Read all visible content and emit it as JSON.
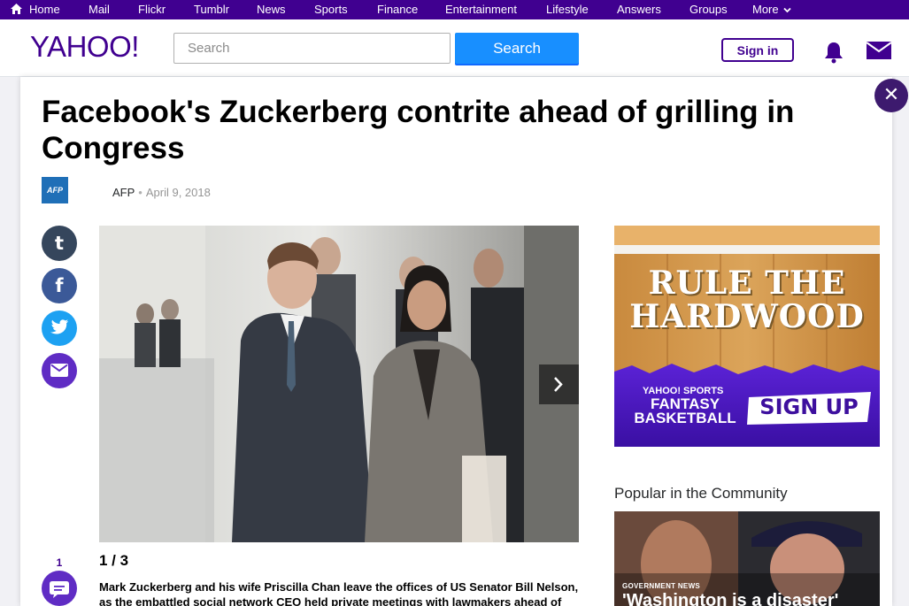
{
  "topnav": {
    "items": [
      "Home",
      "Mail",
      "Flickr",
      "Tumblr",
      "News",
      "Sports",
      "Finance",
      "Entertainment",
      "Lifestyle",
      "Answers",
      "Groups",
      "More"
    ]
  },
  "header": {
    "logo": "YAHOO!",
    "search_placeholder": "Search",
    "search_button": "Search",
    "signin_button": "Sign in"
  },
  "article": {
    "title": "Facebook's Zuckerberg contrite ahead of grilling in Congress",
    "source_logo": "AFP",
    "source": "AFP",
    "separator": "•",
    "date": "April 9, 2018",
    "slide_counter": "1 / 3",
    "caption": "Mark Zuckerberg and his wife Priscilla Chan leave the offices of US Senator Bill Nelson, as the embattled social network CEO held private meetings with lawmakers ahead of",
    "comment_count": "1"
  },
  "share_icons": [
    "tumblr-icon",
    "facebook-icon",
    "twitter-icon",
    "email-icon"
  ],
  "ad": {
    "headline_line1": "RULE THE",
    "headline_line2": "HARDWOOD",
    "brand": "YAHOO! SPORTS",
    "product_line1": "FANTASY",
    "product_line2": "BASKETBALL",
    "cta": "SIGN UP"
  },
  "popular": {
    "title": "Popular in the Community",
    "tag": "GOVERNMENT NEWS",
    "headline": "'Washington is a disaster'"
  },
  "colors": {
    "brand_purple": "#400090",
    "search_blue": "#188fff",
    "tumblr": "#35465c",
    "facebook": "#3b5998",
    "twitter": "#1da1f2",
    "email": "#5f2cc4"
  }
}
